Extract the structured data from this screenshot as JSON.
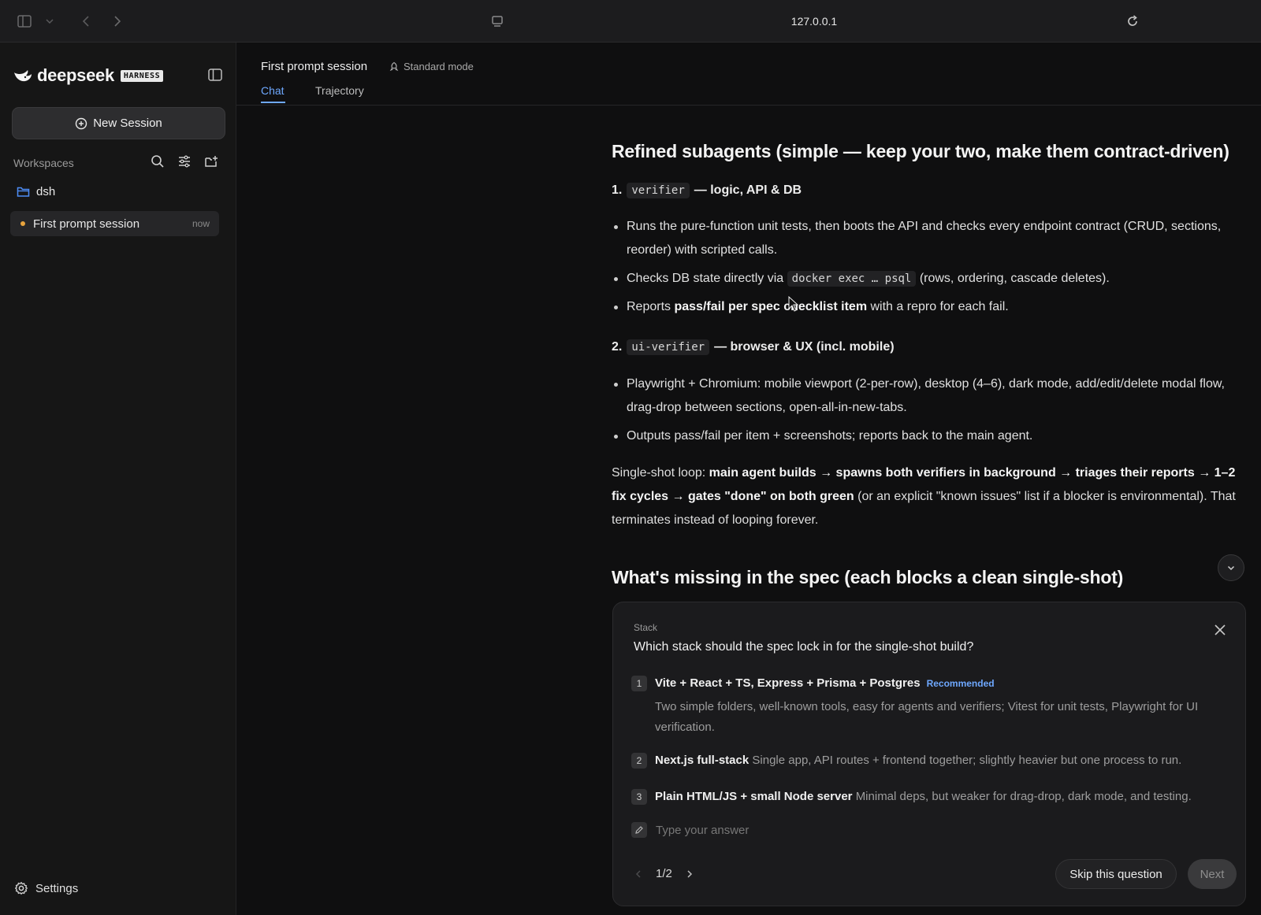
{
  "browser": {
    "url": "127.0.0.1",
    "icons": [
      "sidebar-toggle-icon",
      "chevron-down-icon",
      "back-icon",
      "forward-icon",
      "tab-overview-icon",
      "reload-icon"
    ]
  },
  "sidebar": {
    "brand_word": "deepseek",
    "brand_badge": "HARNESS",
    "new_session_label": "New Session",
    "workspaces_label": "Workspaces",
    "workspace_name": "dsh",
    "sessions": [
      {
        "name": "First prompt session",
        "time": "now",
        "status_color": "#e8a33d"
      }
    ],
    "settings_label": "Settings"
  },
  "header": {
    "session_title": "First prompt session",
    "mode": "Standard mode",
    "tabs": [
      {
        "label": "Chat",
        "active": true
      },
      {
        "label": "Trajectory",
        "active": false
      }
    ]
  },
  "content": {
    "section1_heading": "Refined subagents (simple — keep your two, make them contract-driven)",
    "agent1": {
      "num": "1.",
      "code": "verifier",
      "desc": "— logic, API & DB",
      "b1": "Runs the pure-function unit tests, then boots the API and checks every endpoint contract (CRUD, sections, reorder) with scripted calls.",
      "b2_pre": "Checks DB state directly via",
      "b2_code": "docker exec … psql",
      "b2_post": "(rows, ordering, cascade deletes).",
      "b3_pre": "Reports",
      "b3_bold": "pass/fail per spec checklist item",
      "b3_post": "with a repro for each fail."
    },
    "agent2": {
      "num": "2.",
      "code": "ui-verifier",
      "desc": "— browser & UX (incl. mobile)",
      "b1": "Playwright + Chromium: mobile viewport (2-per-row), desktop (4–6), dark mode, add/edit/delete modal flow, drag-drop between sections, open-all-in-new-tabs.",
      "b2": "Outputs pass/fail per item + screenshots; reports back to the main agent."
    },
    "loop": {
      "pre": "Single-shot loop:",
      "bold": "main agent builds → spawns both verifiers in background → triages their reports → 1–2 fix cycles → gates \"done\" on both green",
      "post": "(or an explicit \"known issues\" list if a blocker is environmental). That terminates instead of looping forever."
    },
    "section2_heading": "What's missing in the spec (each blocks a clean single-shot)"
  },
  "question_panel": {
    "kicker": "Stack",
    "question": "Which stack should the spec lock in for the single-shot build?",
    "options": [
      {
        "num": "1",
        "title": "Vite + React + TS, Express + Prisma + Postgres",
        "badge": "Recommended",
        "desc": "Two simple folders, well-known tools, easy for agents and verifiers; Vitest for unit tests, Playwright for UI verification."
      },
      {
        "num": "2",
        "title": "Next.js full-stack",
        "desc": "Single app, API routes + frontend together; slightly heavier but one process to run."
      },
      {
        "num": "3",
        "title": "Plain HTML/JS + small Node server",
        "desc": "Minimal deps, but weaker for drag-drop, dark mode, and testing."
      }
    ],
    "answer_placeholder": "Type your answer",
    "pager": "1/2",
    "skip_label": "Skip this question",
    "next_label": "Next"
  },
  "colors": {
    "accent": "#6ea8ff",
    "background": "#0f0f10",
    "sidebar": "#161616",
    "status_dot": "#e8a33d"
  }
}
